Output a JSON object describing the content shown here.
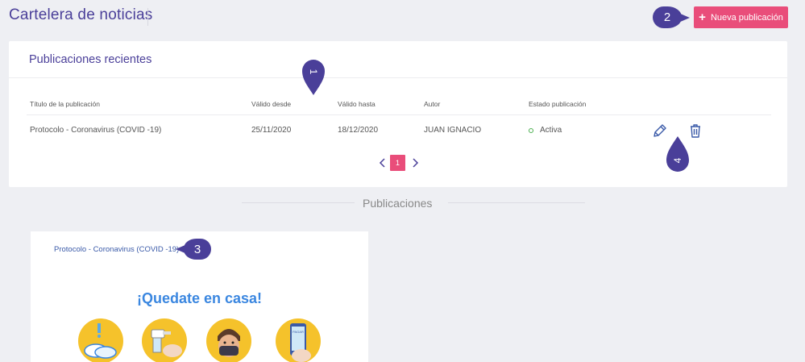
{
  "header": {
    "title": "Cartelera de noticias"
  },
  "toolbar": {
    "new_label": "Nueva publicación",
    "new_icon": "plus-icon"
  },
  "markers": {
    "one": "1",
    "two": "2",
    "three": "3",
    "four": "4"
  },
  "recent": {
    "title": "Publicaciones recientes",
    "columns": [
      "Título de la publicación",
      "Válido desde",
      "Válido hasta",
      "Autor",
      "Estado publicación"
    ],
    "rows": [
      {
        "title": "Protocolo - Coronavirus (COVID -19)",
        "from": "25/11/2020",
        "to": "18/12/2020",
        "author": "JUAN IGNACIO",
        "status": "Activa"
      }
    ],
    "pagination": {
      "current": "1"
    }
  },
  "publications": {
    "section_title": "Publicaciones",
    "card": {
      "link": "Protocolo - Coronavirus (COVID -19)",
      "headline": "¡Quedate en casa!"
    }
  },
  "colors": {
    "accent": "#e94d7a",
    "brand": "#4a3f99",
    "status_active": "#4caf50",
    "link": "#3a5aa8",
    "headline": "#3b87e0",
    "icon_bg": "#f5c22b"
  }
}
